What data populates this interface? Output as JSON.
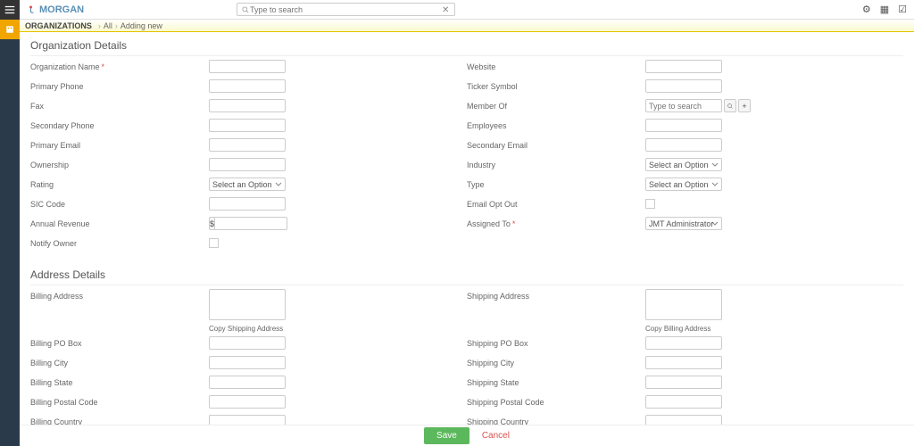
{
  "brand": "MORGAN",
  "search_placeholder": "Type to search",
  "breadcrumb": {
    "main": "ORGANIZATIONS",
    "all": "All",
    "current": "Adding new"
  },
  "section1_title": "Organization Details",
  "section2_title": "Address Details",
  "labels": {
    "org_name": "Organization Name",
    "primary_phone": "Primary Phone",
    "fax": "Fax",
    "secondary_phone": "Secondary Phone",
    "primary_email": "Primary Email",
    "ownership": "Ownership",
    "rating": "Rating",
    "sic_code": "SIC Code",
    "annual_revenue": "Annual Revenue",
    "notify_owner": "Notify Owner",
    "website": "Website",
    "ticker_symbol": "Ticker Symbol",
    "member_of": "Member Of",
    "employees": "Employees",
    "secondary_email": "Secondary Email",
    "industry": "Industry",
    "type": "Type",
    "email_opt_out": "Email Opt Out",
    "assigned_to": "Assigned To",
    "billing_address": "Billing Address",
    "billing_po_box": "Billing PO Box",
    "billing_city": "Billing City",
    "billing_state": "Billing State",
    "billing_postal_code": "Billing Postal Code",
    "billing_country": "Billing Country",
    "shipping_address": "Shipping Address",
    "shipping_po_box": "Shipping PO Box",
    "shipping_city": "Shipping City",
    "shipping_state": "Shipping State",
    "shipping_postal_code": "Shipping Postal Code",
    "shipping_country": "Shipping Country"
  },
  "placeholders": {
    "select_option": "Select an Option",
    "type_to_search": "Type to search"
  },
  "values": {
    "currency_symbol": "$",
    "assigned_to": "JMT Administrator"
  },
  "links": {
    "copy_shipping": "Copy Shipping Address",
    "copy_billing": "Copy Billing Address"
  },
  "buttons": {
    "save": "Save",
    "cancel": "Cancel",
    "search": "🔍",
    "plus": "+"
  }
}
